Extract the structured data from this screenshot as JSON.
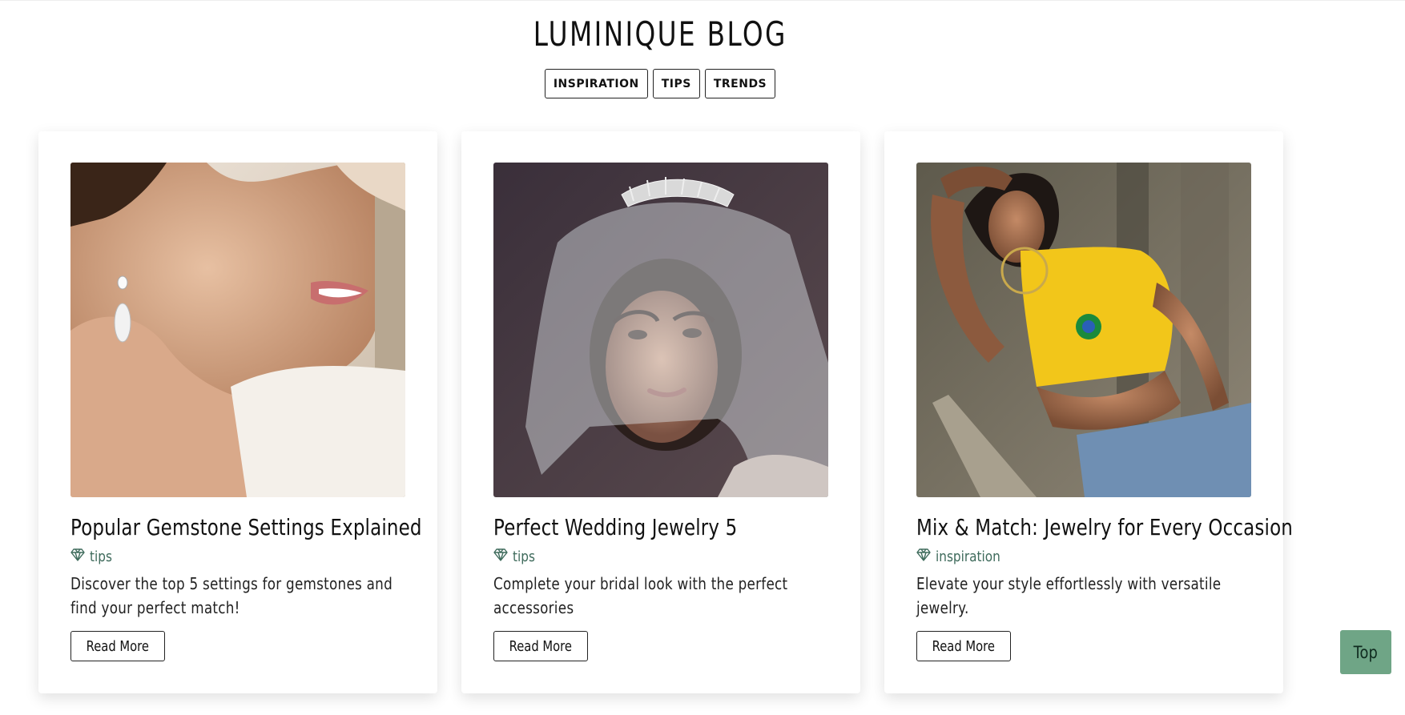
{
  "header": {
    "title": "LUMINIQUE BLOG"
  },
  "filters": [
    {
      "label": "INSPIRATION"
    },
    {
      "label": "TIPS"
    },
    {
      "label": "TRENDS"
    }
  ],
  "posts": [
    {
      "title": "Popular Gemstone Settings Explained",
      "tag": "tips",
      "tag_icon": "gem-icon",
      "description": "Discover the top 5 settings for gemstones and find your perfect match!",
      "read_more": "Read More",
      "image": "woman-putting-on-drop-earring"
    },
    {
      "title": "Perfect Wedding Jewelry 5",
      "tag": "tips",
      "tag_icon": "gem-icon",
      "description": "Complete your bridal look with the perfect accessories",
      "read_more": "Read More",
      "image": "bride-with-veil-and-tiara"
    },
    {
      "title": "Mix & Match: Jewelry for Every Occasion",
      "tag": "inspiration",
      "tag_icon": "gem-icon",
      "description": "Elevate your style effortlessly with versatile jewelry.",
      "read_more": "Read More",
      "image": "woman-in-yellow-top-with-hoop-earrings"
    }
  ],
  "back_to_top": {
    "label": "Top"
  },
  "colors": {
    "accent": "#6fa586",
    "tag_text": "#3f6b5c",
    "border": "#222222"
  }
}
